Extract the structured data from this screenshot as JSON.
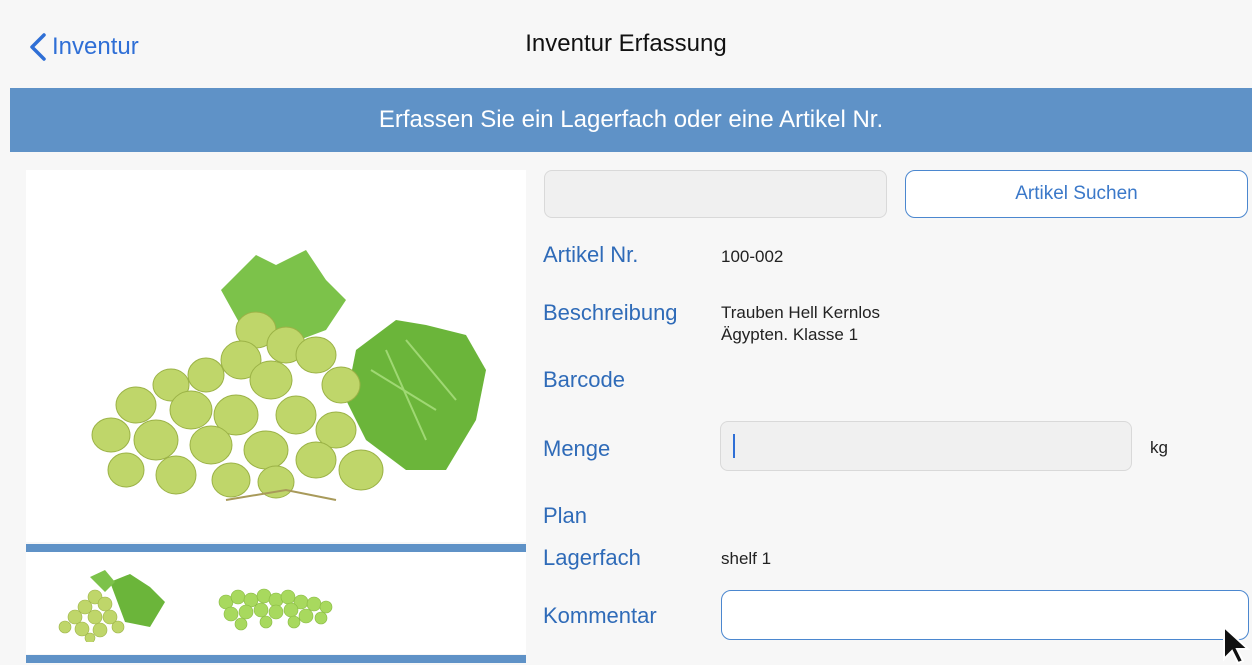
{
  "navbar": {
    "back_label": "Inventur",
    "title": "Inventur Erfassung"
  },
  "banner": {
    "text": "Erfassen Sie ein Lagerfach oder eine Artikel Nr."
  },
  "search": {
    "input_value": "",
    "button_label": "Artikel Suchen"
  },
  "details": {
    "artikel_nr_label": "Artikel Nr.",
    "artikel_nr_value": "100-002",
    "beschreibung_label": "Beschreibung",
    "beschreibung_line1": "Trauben Hell Kernlos",
    "beschreibung_line2": "Ägypten. Klasse 1",
    "barcode_label": "Barcode",
    "menge_label": "Menge",
    "menge_value": "",
    "menge_unit": "kg",
    "plan_label": "Plan",
    "lagerfach_label": "Lagerfach",
    "lagerfach_value": "shelf 1",
    "kommentar_label": "Kommentar",
    "kommentar_value": ""
  },
  "icons": {
    "back": "chevron-left-icon",
    "cursor": "mouse-pointer-icon"
  },
  "colors": {
    "accent": "#2f6fd6",
    "banner": "#5f92c7",
    "label": "#2f6bb8"
  }
}
